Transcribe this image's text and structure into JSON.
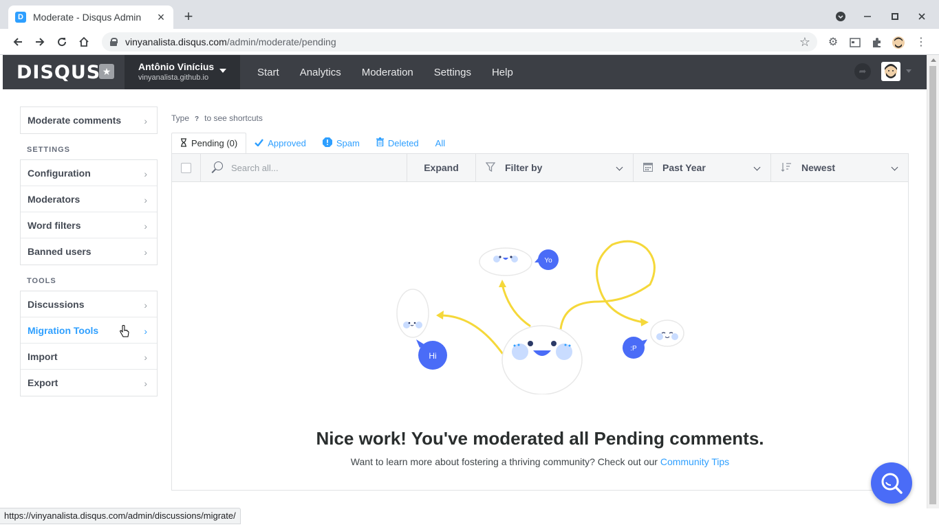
{
  "browser": {
    "tab_title": "Moderate - Disqus Admin",
    "favicon_letter": "D",
    "url_host": "vinyanalista.disqus.com",
    "url_path": "/admin/moderate/pending",
    "status_url": "https://vinyanalista.disqus.com/admin/discussions/migrate/"
  },
  "header": {
    "logo": "DISQUS",
    "site_name": "Antônio Vinícius",
    "site_domain": "vinyanalista.github.io",
    "nav": [
      {
        "label": "Start"
      },
      {
        "label": "Analytics"
      },
      {
        "label": "Moderation"
      },
      {
        "label": "Settings"
      },
      {
        "label": "Help"
      }
    ]
  },
  "sidebar": {
    "top_item": "Moderate comments",
    "settings_heading": "SETTINGS",
    "settings_items": [
      {
        "label": "Configuration"
      },
      {
        "label": "Moderators"
      },
      {
        "label": "Word filters"
      },
      {
        "label": "Banned users"
      }
    ],
    "tools_heading": "TOOLS",
    "tools_items": [
      {
        "label": "Discussions"
      },
      {
        "label": "Migration Tools"
      },
      {
        "label": "Import"
      },
      {
        "label": "Export"
      }
    ]
  },
  "main": {
    "hint_prefix": "Type",
    "hint_key": "?",
    "hint_suffix": "to see shortcuts",
    "tabs": [
      {
        "label": "Pending (0)",
        "icon": "hourglass-icon"
      },
      {
        "label": "Approved",
        "icon": "check-icon"
      },
      {
        "label": "Spam",
        "icon": "alert-icon"
      },
      {
        "label": "Deleted",
        "icon": "trash-icon"
      },
      {
        "label": "All"
      }
    ],
    "toolbar": {
      "search_placeholder": "Search all...",
      "expand_label": "Expand",
      "filter_label": "Filter by",
      "date_label": "Past Year",
      "sort_label": "Newest"
    },
    "bubbles": {
      "hi": "Hi",
      "yo": "Yo",
      "p": ":P"
    },
    "empty_title": "Nice work! You've moderated all Pending comments.",
    "empty_sub_prefix": "Want to learn more about fostering a thriving community? Check out our",
    "empty_sub_link": "Community Tips"
  },
  "colors": {
    "accent": "#2e9fff",
    "header_bg": "#3c3f45",
    "fab": "#4a6cf7",
    "illustration_yellow": "#f5d83a"
  }
}
